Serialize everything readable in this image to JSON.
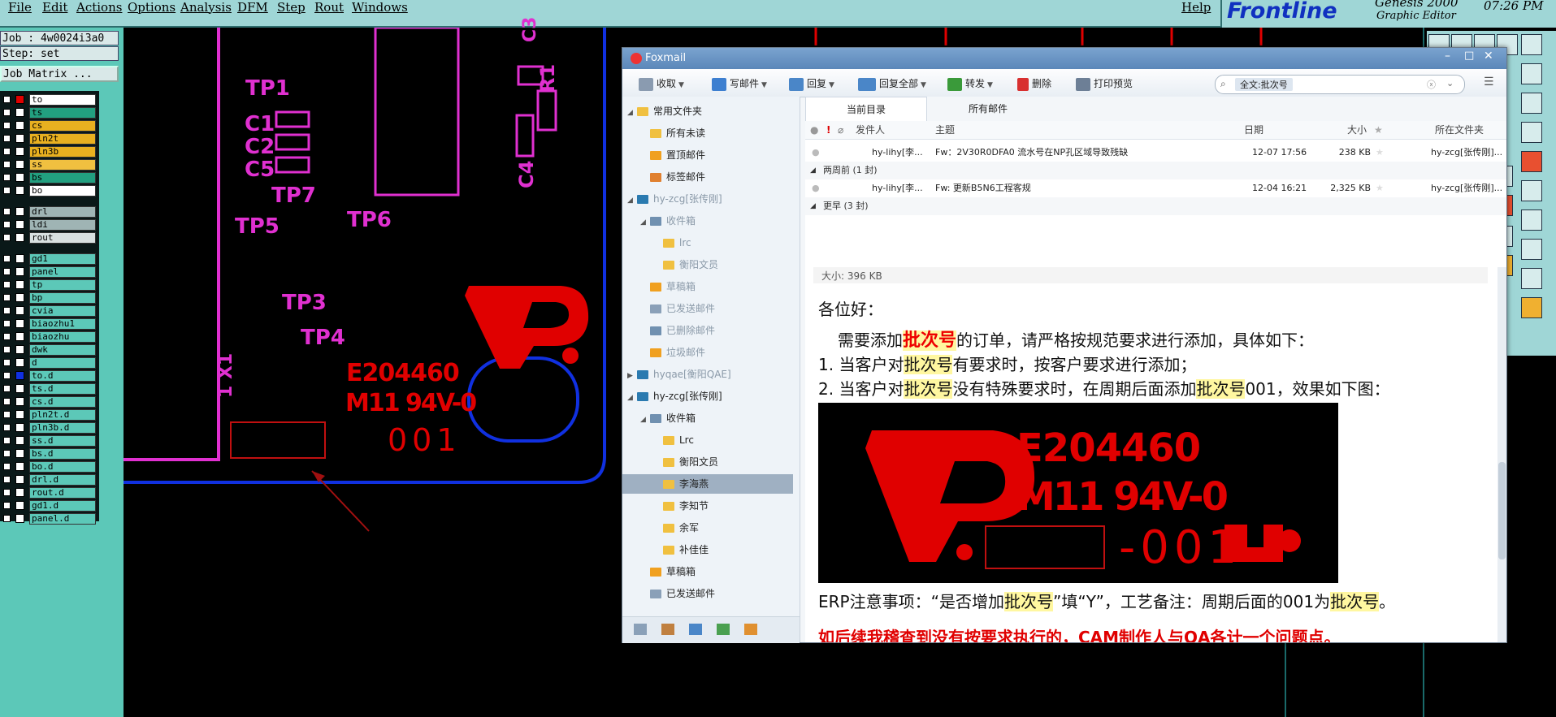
{
  "genesis": {
    "menus": [
      "File",
      "Edit",
      "Actions",
      "Options",
      "Analysis",
      "DFM",
      "Step",
      "Rout",
      "Windows"
    ],
    "help": "Help",
    "brand": "Frontline",
    "brand_title": "Genesis 2000",
    "brand_sub": "Graphic Editor",
    "clock": "07:26 PM",
    "job": "Job : 4w0024i3a0",
    "step": "Step: set",
    "job_matrix": "Job Matrix ...",
    "layers": [
      {
        "name": "to",
        "color": "#ffffff",
        "mark": "#e00000"
      },
      {
        "name": "ts",
        "color": "#22a080",
        "mark": null
      },
      {
        "name": "cs",
        "color": "#e8b020",
        "mark": null
      },
      {
        "name": "pln2t",
        "color": "#e8b020",
        "mark": null
      },
      {
        "name": "pln3b",
        "color": "#e8b020",
        "mark": null
      },
      {
        "name": "ss",
        "color": "#f0c040",
        "mark": null
      },
      {
        "name": "bs",
        "color": "#22a080",
        "mark": null
      },
      {
        "name": "bo",
        "color": "#ffffff",
        "mark": null
      },
      {
        "name": "drl",
        "color": "#9fb4b4",
        "mark": null
      },
      {
        "name": "ldi",
        "color": "#9fb4b4",
        "mark": null
      },
      {
        "name": "rout",
        "color": "#d8e0e0",
        "mark": null
      },
      {
        "name": "gd1",
        "color": "#5cc8b8",
        "mark": null
      },
      {
        "name": "panel",
        "color": "#5cc8b8",
        "mark": null
      },
      {
        "name": "tp",
        "color": "#5cc8b8",
        "mark": null
      },
      {
        "name": "bp",
        "color": "#5cc8b8",
        "mark": null
      },
      {
        "name": "cvia",
        "color": "#5cc8b8",
        "mark": null
      },
      {
        "name": "biaozhu1",
        "color": "#5cc8b8",
        "mark": null
      },
      {
        "name": "biaozhu",
        "color": "#5cc8b8",
        "mark": null
      },
      {
        "name": "dwk",
        "color": "#5cc8b8",
        "mark": null
      },
      {
        "name": "d",
        "color": "#5cc8b8",
        "mark": null
      },
      {
        "name": "to.d",
        "color": "#5cc8b8",
        "mark": "#1030e0"
      },
      {
        "name": "ts.d",
        "color": "#5cc8b8",
        "mark": null
      },
      {
        "name": "cs.d",
        "color": "#5cc8b8",
        "mark": null
      },
      {
        "name": "pln2t.d",
        "color": "#5cc8b8",
        "mark": null
      },
      {
        "name": "pln3b.d",
        "color": "#5cc8b8",
        "mark": null
      },
      {
        "name": "ss.d",
        "color": "#5cc8b8",
        "mark": null
      },
      {
        "name": "bs.d",
        "color": "#5cc8b8",
        "mark": null
      },
      {
        "name": "bo.d",
        "color": "#5cc8b8",
        "mark": null
      },
      {
        "name": "drl.d",
        "color": "#5cc8b8",
        "mark": null
      },
      {
        "name": "rout.d",
        "color": "#5cc8b8",
        "mark": null
      },
      {
        "name": "gd1.d",
        "color": "#5cc8b8",
        "mark": null
      },
      {
        "name": "panel.d",
        "color": "#5cc8b8",
        "mark": null
      }
    ],
    "pcb_labels": {
      "tp1": "TP1",
      "c1": "C1",
      "c2": "C2",
      "c5": "C5",
      "tp7": "TP7",
      "tp5": "TP5",
      "tp6": "TP6",
      "tp3": "TP3",
      "tp4": "TP4",
      "x1": "1 X1",
      "c4": "C4",
      "r1": "R1",
      "c3": "C3",
      "ul_number": "E204460",
      "ul_grade": "M11 94V-0",
      "date_code": "001"
    }
  },
  "foxmail": {
    "title": "Foxmail",
    "toolbar": {
      "receive": "收取",
      "write": "写邮件",
      "reply": "回复",
      "reply_all": "回复全部",
      "forward": "转发",
      "delete": "删除",
      "print_preview": "打印预览"
    },
    "search_value": "全文:批次号",
    "tabs": [
      "当前目录",
      "所有邮件"
    ],
    "columns": {
      "sender": "发件人",
      "subject": "主题",
      "date": "日期",
      "size": "大小",
      "folder": "所在文件夹"
    },
    "folders": {
      "common_header": "常用文件夹",
      "unread": "所有未读",
      "pinned": "置顶邮件",
      "tagged": "标签邮件",
      "account1": "hy-zcg[张传刚]",
      "inbox1": "收件箱",
      "sub_lrc1": "lrc",
      "sub_hengyang1": "衡阳文员",
      "drafts1": "草稿箱",
      "sent1": "已发送邮件",
      "deleted1": "已删除邮件",
      "junk1": "垃圾邮件",
      "account2": "hyqae[衡阳QAE]",
      "account3": "hy-zcg[张传刚]",
      "inbox3": "收件箱",
      "sub_lrc3": "Lrc",
      "sub_hengyang3": "衡阳文员",
      "sub_lihaiyan": "李海燕",
      "sub_lizhijie": "李知节",
      "sub_yujun": "余军",
      "sub_buji": "补佳佳",
      "drafts3": "草稿箱",
      "sent3": "已发送邮件"
    },
    "groups": {
      "two_weeks": "两周前 (1 封)",
      "earlier": "更早 (3 封)"
    },
    "emails": [
      {
        "sender": "hy-lihy[李...",
        "subject": "Fw：2V30R0DFA0  流水号在NP孔区域导致残缺",
        "date": "12-07 17:56",
        "size": "238 KB",
        "folder": "hy-zcg[张传刚]..."
      },
      {
        "sender": "hy-lihy[李...",
        "subject": "Fw: 更新B5N6工程客规",
        "date": "12-04 16:21",
        "size": "2,325 KB",
        "folder": "hy-zcg[张传刚]..."
      }
    ],
    "attachment_size": "大小: 396 KB",
    "body": {
      "greeting": "各位好：",
      "intro_pre": "需要添加",
      "intro_kw": "批次号",
      "intro_post": "的订单，请严格按规范要求进行添加，具体如下：",
      "item1_pre": "1. 当客户对",
      "item1_kw": "批次号",
      "item1_post": "有要求时，按客户要求进行添加；",
      "item2_pre": "2. 当客户对",
      "item2_kw": "批次号",
      "item2_mid": "没有特殊要求时，在周期后面添加",
      "item2_kw2": "批次号",
      "item2_post": "001，效果如下图：",
      "img_ul": "E204460",
      "img_grade": "M11 94V-0",
      "img_code": "-001",
      "erp_pre": "ERP注意事项：“是否增加",
      "erp_kw": "批次号",
      "erp_mid": "”填“Y”，工艺备注：周期后面的001为",
      "erp_kw2": "批次号",
      "erp_post": "。",
      "warning": "如后续我稽查到没有按要求执行的，CAM制作人与QA各计一个问题点。"
    }
  }
}
